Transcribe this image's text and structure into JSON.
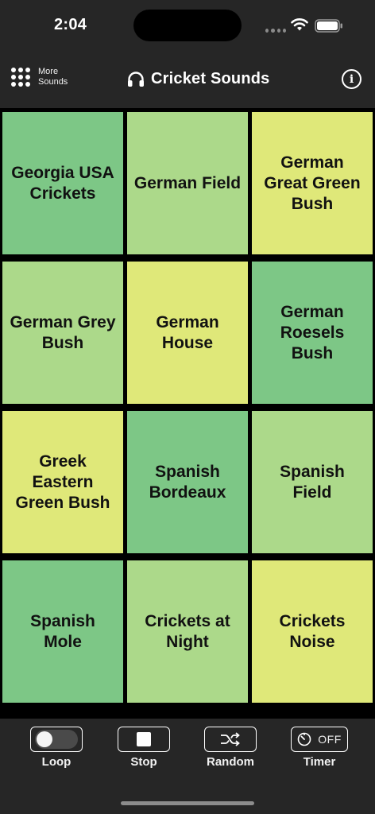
{
  "status_bar": {
    "time": "2:04"
  },
  "header": {
    "more_sounds_label": "More\nSounds",
    "title": "Cricket Sounds",
    "info_icon": "info-icon"
  },
  "sounds": [
    {
      "label": "Georgia USA\nCrickets",
      "color": "#7dc786"
    },
    {
      "label": "German Field",
      "color": "#acd98a"
    },
    {
      "label": "German\nGreat Green\nBush",
      "color": "#dfe879"
    },
    {
      "label": "German Grey\nBush",
      "color": "#acd98a"
    },
    {
      "label": "German\nHouse",
      "color": "#dfe879"
    },
    {
      "label": "German\nRoesels\nBush",
      "color": "#7dc786"
    },
    {
      "label": "Greek\nEastern\nGreen Bush",
      "color": "#dfe879"
    },
    {
      "label": "Spanish\nBordeaux",
      "color": "#7dc786"
    },
    {
      "label": "Spanish\nField",
      "color": "#acd98a"
    },
    {
      "label": "Spanish\nMole",
      "color": "#7dc786"
    },
    {
      "label": "Crickets at\nNight",
      "color": "#acd98a"
    },
    {
      "label": "Crickets\nNoise",
      "color": "#dfe879"
    }
  ],
  "controls": {
    "loop_label": "Loop",
    "stop_label": "Stop",
    "random_label": "Random",
    "timer_label": "Timer",
    "timer_state": "OFF",
    "loop_on": false
  }
}
